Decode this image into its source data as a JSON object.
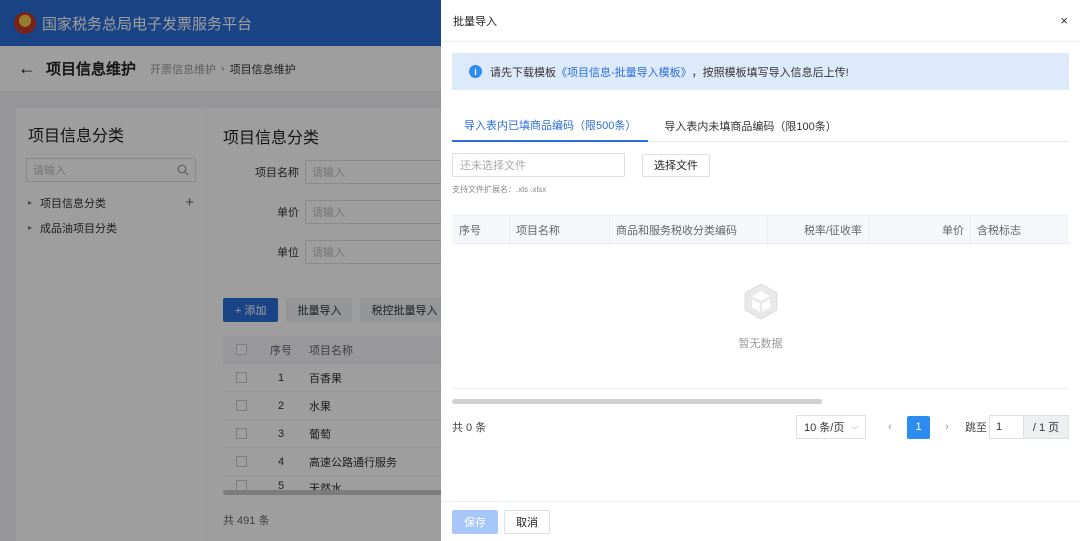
{
  "app": {
    "title": "国家税务总局电子发票服务平台"
  },
  "header": {
    "page_title": "项目信息维护",
    "breadcrumb": [
      "开票信息维护",
      "项目信息维护"
    ],
    "breadcrumb_sep": "›"
  },
  "sidebar": {
    "title": "项目信息分类",
    "search_placeholder": "请输入",
    "tree": [
      {
        "label": "项目信息分类"
      },
      {
        "label": "成品油项目分类"
      }
    ]
  },
  "main": {
    "title": "项目信息分类",
    "fields": [
      {
        "label": "项目名称",
        "placeholder": "请输入"
      },
      {
        "label": "单价",
        "placeholder": "请输入"
      },
      {
        "label": "单位",
        "placeholder": "请输入"
      }
    ],
    "buttons": {
      "add": "+ 添加",
      "batch_import": "批量导入",
      "tax_batch_import": "税控批量导入"
    },
    "table": {
      "headers": {
        "seq": "序号",
        "name": "项目名称"
      },
      "rows": [
        {
          "seq": "1",
          "name": "百香果"
        },
        {
          "seq": "2",
          "name": "水果"
        },
        {
          "seq": "3",
          "name": "葡萄"
        },
        {
          "seq": "4",
          "name": "高速公路通行服务"
        },
        {
          "seq": "5",
          "name": "天然水"
        }
      ]
    },
    "total": "共 491 条"
  },
  "drawer": {
    "title": "批量导入",
    "close": "×",
    "notice": {
      "prefix": "请先下载模板",
      "link": "《项目信息-批量导入模板》",
      "suffix": "，按照模板填写导入信息后上传!"
    },
    "tabs": [
      "导入表内已填商品编码（限500条）",
      "导入表内未填商品编码（限100条）"
    ],
    "file": {
      "placeholder": "还未选择文件",
      "button": "选择文件",
      "hint": "支持文件扩展名：.xls .xlsx"
    },
    "table": {
      "headers": {
        "seq": "序号",
        "name": "项目名称",
        "code": "商品和服务税收分类编码",
        "rate": "税率/征收率",
        "price": "单价",
        "tax_flag": "含税标志"
      },
      "empty_text": "暂无数据"
    },
    "pager": {
      "total": "共 0 条",
      "page_size": "10 条/页",
      "prev": "‹",
      "current": "1",
      "next": "›",
      "jump_label": "跳至",
      "jump_value": "1",
      "page_total": "/ 1 页"
    },
    "footer": {
      "save": "保存",
      "cancel": "取消"
    }
  }
}
